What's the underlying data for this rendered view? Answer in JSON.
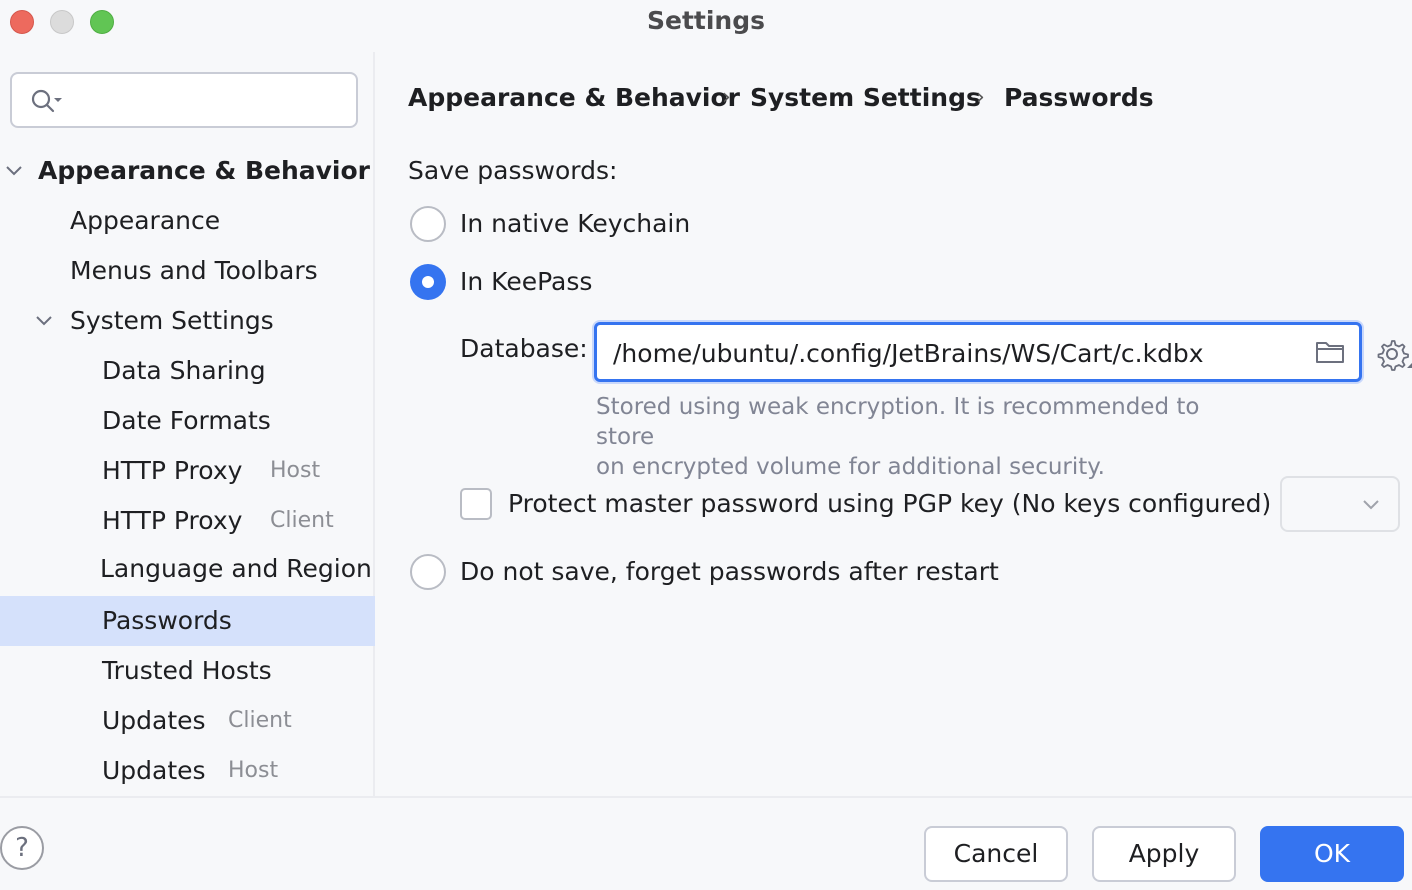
{
  "window": {
    "title": "Settings"
  },
  "search": {
    "placeholder": "",
    "value": ""
  },
  "sidebar": {
    "items": [
      {
        "label": "Appearance & Behavior"
      },
      {
        "label": "Appearance"
      },
      {
        "label": "Menus and Toolbars"
      },
      {
        "label": "System Settings"
      },
      {
        "label": "Data Sharing"
      },
      {
        "label": "Date Formats"
      },
      {
        "label": "HTTP Proxy",
        "tag": "Host"
      },
      {
        "label": "HTTP Proxy",
        "tag": "Client"
      },
      {
        "label": "Language and Region"
      },
      {
        "label": "Passwords",
        "selected": true
      },
      {
        "label": "Trusted Hosts"
      },
      {
        "label": "Updates",
        "tag": "Client"
      },
      {
        "label": "Updates",
        "tag": "Host"
      }
    ]
  },
  "breadcrumb": {
    "parts": [
      "Appearance & Behavior",
      "System Settings",
      "Passwords"
    ],
    "separator": "›"
  },
  "passwords": {
    "section_label": "Save passwords:",
    "options": [
      {
        "label": "In native Keychain",
        "checked": false
      },
      {
        "label": "In KeePass",
        "checked": true
      },
      {
        "label": "Do not save, forget passwords after restart",
        "checked": false
      }
    ],
    "database_label": "Database:",
    "database_value": "/home/ubuntu/.config/JetBrains/WS/Cart/c.kdbx",
    "hint_line1": "Stored using weak encryption. It is recommended to store",
    "hint_line2": "on encrypted volume for additional security.",
    "pgp_label": "Protect master password using PGP key (No keys configured)",
    "pgp_checked": false,
    "pgp_selected": ""
  },
  "footer": {
    "help_label": "?",
    "cancel_label": "Cancel",
    "apply_label": "Apply",
    "ok_label": "OK"
  },
  "colors": {
    "accent": "#3574f0",
    "selection": "#d5e1fb",
    "background": "#f7f8fa"
  }
}
